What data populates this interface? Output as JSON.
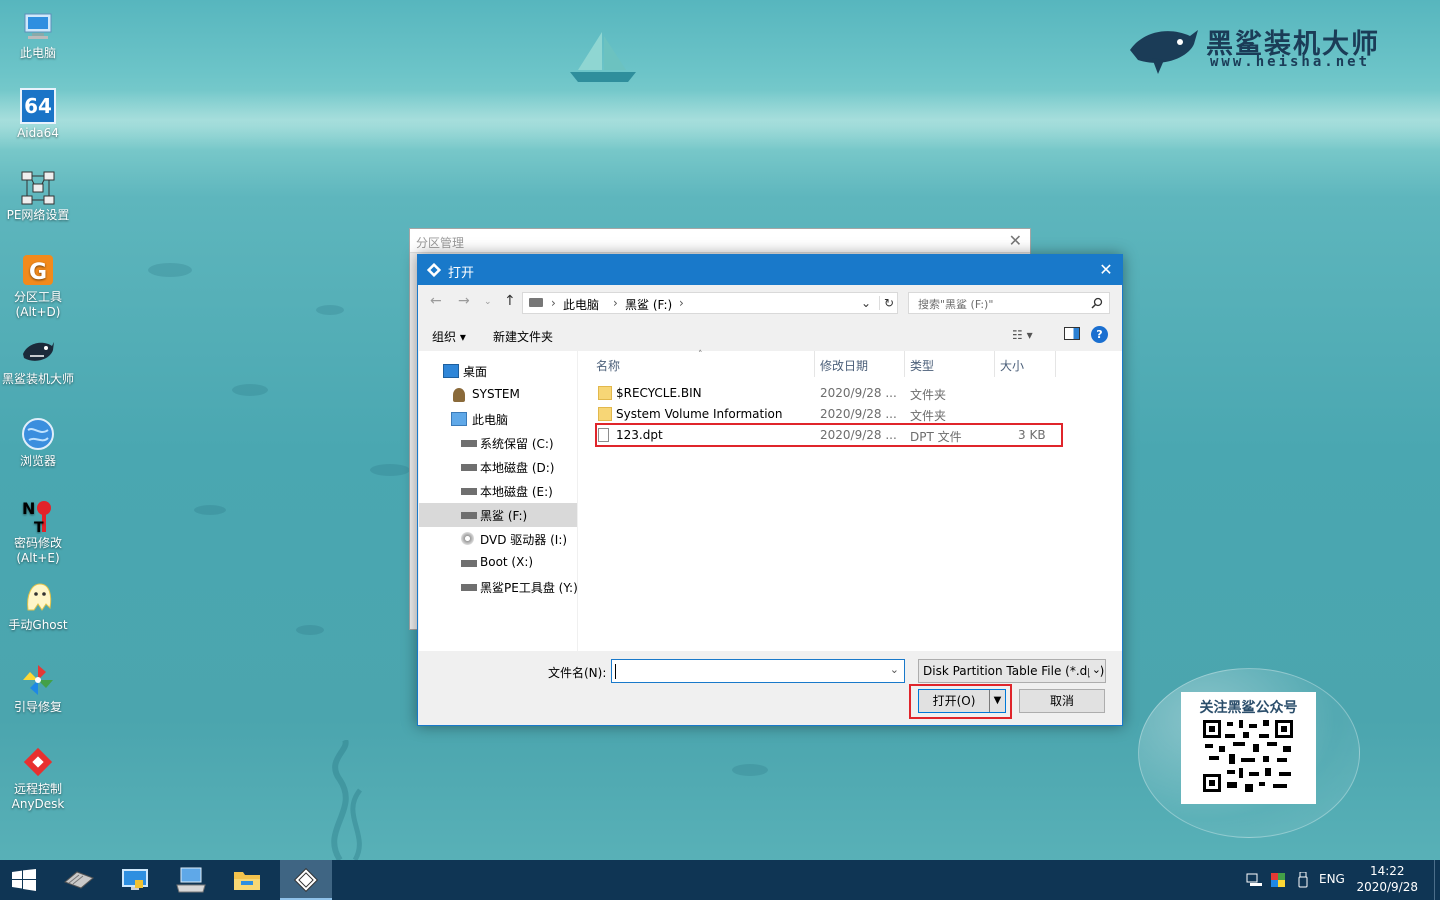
{
  "desktop": {
    "icons": [
      {
        "label": "此电脑"
      },
      {
        "label": "Aida64"
      },
      {
        "label": "PE网络设置"
      },
      {
        "label": "分区工具\n(Alt+D)"
      },
      {
        "label": "黑鲨装机大师"
      },
      {
        "label": "浏览器"
      },
      {
        "label": "密码修改\n(Alt+E)"
      },
      {
        "label": "手动Ghost"
      },
      {
        "label": "引导修复"
      },
      {
        "label": "远程控制\nAnyDesk"
      }
    ],
    "aida_badge": "64",
    "logo_title": "黑鲨装机大师",
    "logo_url": "www.heisha.net",
    "qr_title": "关注黑鲨公众号"
  },
  "back_window": {
    "title": "分区管理"
  },
  "dialog": {
    "title": "打开",
    "breadcrumb": [
      "此电脑",
      "黑鲨 (F:)"
    ],
    "search_placeholder": "搜索\"黑鲨 (F:)\"",
    "toolbar": {
      "organize": "组织",
      "new_folder": "新建文件夹"
    },
    "tree": [
      {
        "label": "桌面",
        "icon": "desktop-icon"
      },
      {
        "label": "SYSTEM",
        "icon": "user-icon"
      },
      {
        "label": "此电脑",
        "icon": "computer-icon"
      },
      {
        "label": "系统保留 (C:)",
        "icon": "drive-icon"
      },
      {
        "label": "本地磁盘 (D:)",
        "icon": "drive-icon"
      },
      {
        "label": "本地磁盘 (E:)",
        "icon": "drive-icon"
      },
      {
        "label": "黑鲨 (F:)",
        "icon": "drive-icon"
      },
      {
        "label": "DVD 驱动器 (I:)",
        "icon": "dvd-icon"
      },
      {
        "label": "Boot (X:)",
        "icon": "drive-icon"
      },
      {
        "label": "黑鲨PE工具盘 (Y:)",
        "icon": "drive-icon"
      }
    ],
    "columns": [
      "名称",
      "修改日期",
      "类型",
      "大小"
    ],
    "files": [
      {
        "name": "$RECYCLE.BIN",
        "date": "2020/9/28 ...",
        "type": "文件夹",
        "size": "",
        "icon": "folder-icon"
      },
      {
        "name": "System Volume Information",
        "date": "2020/9/28 ...",
        "type": "文件夹",
        "size": "",
        "icon": "folder-icon"
      },
      {
        "name": "123.dpt",
        "date": "2020/9/28 ...",
        "type": "DPT 文件",
        "size": "3 KB",
        "icon": "file-icon"
      }
    ],
    "filename_label": "文件名(N):",
    "filename_value": "",
    "filetype_value": "Disk Partition Table File (*.dpt)",
    "open_button": "打开(O)",
    "cancel_button": "取消"
  },
  "taskbar": {
    "lang": "ENG",
    "time": "14:22",
    "date": "2020/9/28"
  },
  "colors": {
    "accent": "#1979ca",
    "highlight": "#e0252b",
    "taskbar": "#0f3554"
  }
}
